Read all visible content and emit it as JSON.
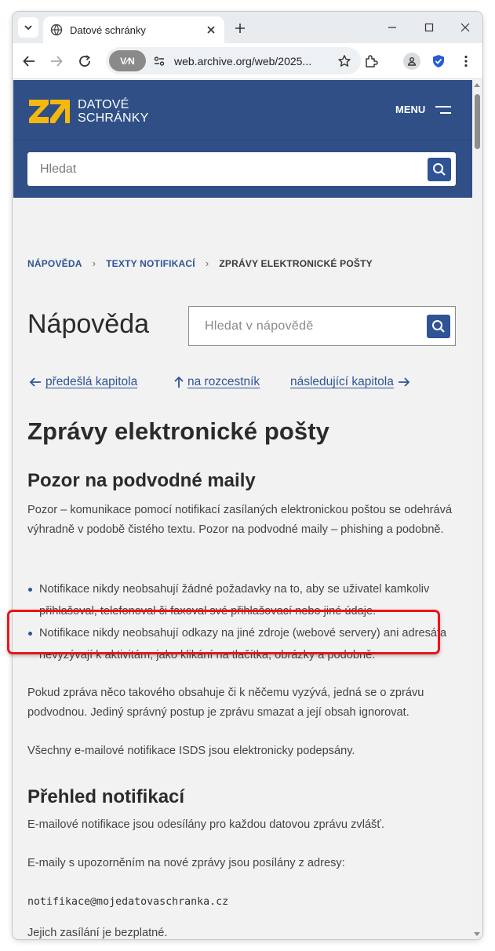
{
  "browser": {
    "tab_title": "Datové schránky",
    "url": "web.archive.org/web/2025...",
    "vpn_label": "V⁄N",
    "icons": [
      "tab-search-icon",
      "globe-icon",
      "close-icon",
      "plus-icon",
      "minimize-icon",
      "maximize-icon",
      "window-close-icon",
      "back-icon",
      "forward-icon",
      "reload-icon",
      "site-info-icon",
      "star-icon",
      "extensions-icon",
      "profile-icon",
      "shield-icon",
      "kebab-menu-icon"
    ]
  },
  "header": {
    "logo_line1": "DATOVÉ",
    "logo_line2": "SCHRÁNKY",
    "menu_label": "MENU",
    "search_placeholder": "Hledat",
    "brand_color": "#2f4f86",
    "logo_color": "#f5b80e"
  },
  "breadcrumb": {
    "items": [
      "NÁPOVĚDA",
      "TEXTY NOTIFIKACÍ"
    ],
    "current": "ZPRÁVY ELEKTRONICKÉ POŠTY"
  },
  "help": {
    "title": "Nápověda",
    "search_placeholder": "Hledat v nápovědě"
  },
  "chapter_nav": {
    "prev": "předešlá kapitola",
    "up": "na rozcestník",
    "next": "následující kapitola"
  },
  "article": {
    "title": "Zprávy elektronické pošty",
    "section1": {
      "heading": "Pozor na podvodné maily",
      "intro": "Pozor – komunikace pomocí notifikací zasílaných elektronickou poštou se odehrává výhradně v podobě čistého textu. Pozor na podvodné maily – phishing a podobně.",
      "bullets": [
        "Notifikace nikdy neobsahují žádné požadavky na to, aby se uživatel kamkoliv přihlašoval, telefonoval či faxoval své přihlašovací nebo jiné údaje.",
        "Notifikace nikdy neobsahují odkazy na jiné zdroje (webové servery) ani adresáta nevyzývají k aktivitám, jako klikání na tlačítka, obrázky a podobně."
      ],
      "para2": "Pokud zpráva něco takového obsahuje či k něčemu vyzývá, jedná se o zprávu podvodnou. Jediný správný postup je zprávu smazat a její obsah ignorovat.",
      "para3": "Všechny e-mailové notifikace ISDS jsou elektronicky podepsány."
    },
    "section2": {
      "heading": "Přehled notifikací",
      "para1": "E-mailové notifikace jsou odesílány pro každou datovou zprávu zvlášť.",
      "para2": "E-maily s upozorněním na nové zprávy jsou posílány z adresy:",
      "email": "notifikace@mojedatovaschranka.cz",
      "para3": "Jejich zasílání je bezplatné."
    }
  },
  "annotation_color": "#e8151b"
}
